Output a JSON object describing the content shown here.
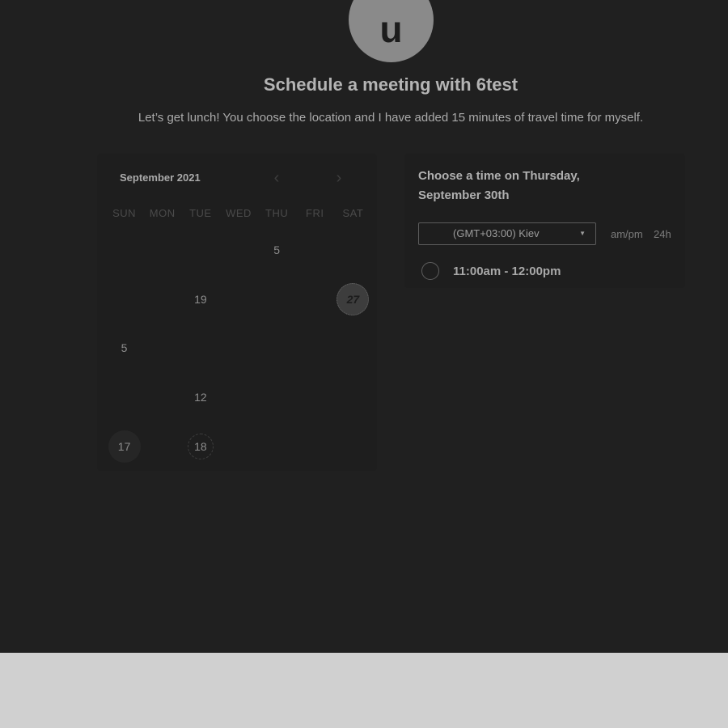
{
  "host": {
    "avatar_initial": "u",
    "title": "Schedule a meeting with 6test",
    "description": "Let’s get lunch! You choose the location and I have added 15 minutes of travel time for myself."
  },
  "calendar": {
    "month_label": "September 2021",
    "prev_icon": "chevron-left-icon",
    "next_icon": "chevron-right-icon",
    "weekdays": [
      "SUN",
      "MON",
      "TUE",
      "WED",
      "THU",
      "FRI",
      "SAT"
    ],
    "weeks": [
      [
        {
          "label": "",
          "state": "disabled"
        },
        {
          "label": "",
          "state": "disabled"
        },
        {
          "label": "",
          "state": "disabled"
        },
        {
          "label": "",
          "state": "disabled"
        },
        {
          "label": "5",
          "state": "available"
        },
        {
          "label": "",
          "state": "disabled"
        },
        {
          "label": "",
          "state": "disabled"
        }
      ],
      [
        {
          "label": "",
          "state": "disabled"
        },
        {
          "label": "",
          "state": "disabled"
        },
        {
          "label": "19",
          "state": "available"
        },
        {
          "label": "",
          "state": "disabled"
        },
        {
          "label": "",
          "state": "disabled"
        },
        {
          "label": "",
          "state": "disabled"
        },
        {
          "label": "27",
          "state": "selected"
        }
      ],
      [
        {
          "label": "5",
          "state": "available"
        },
        {
          "label": "",
          "state": "disabled"
        },
        {
          "label": "",
          "state": "disabled"
        },
        {
          "label": "",
          "state": "disabled"
        },
        {
          "label": "",
          "state": "disabled"
        },
        {
          "label": "",
          "state": "disabled"
        },
        {
          "label": "",
          "state": "disabled"
        }
      ],
      [
        {
          "label": "",
          "state": "disabled"
        },
        {
          "label": "",
          "state": "disabled"
        },
        {
          "label": "12",
          "state": "available"
        },
        {
          "label": "",
          "state": "disabled"
        },
        {
          "label": "",
          "state": "disabled"
        },
        {
          "label": "",
          "state": "disabled"
        },
        {
          "label": "",
          "state": "disabled"
        }
      ],
      [
        {
          "label": "17",
          "state": "highlight"
        },
        {
          "label": "",
          "state": "disabled"
        },
        {
          "label": "18",
          "state": "today"
        },
        {
          "label": "",
          "state": "disabled"
        },
        {
          "label": "",
          "state": "disabled"
        },
        {
          "label": "",
          "state": "disabled"
        },
        {
          "label": "",
          "state": "disabled"
        }
      ]
    ]
  },
  "times": {
    "heading": "Choose a time on Thursday, September 30th",
    "timezone": "(GMT+03:00) Kiev",
    "format_ampm": "am/pm",
    "format_24h": "24h",
    "slots": [
      {
        "label": "11:00am - 12:00pm",
        "selected": false
      }
    ]
  },
  "colors": {
    "page_background": "#202020",
    "footer_background": "#d0d0d0"
  }
}
